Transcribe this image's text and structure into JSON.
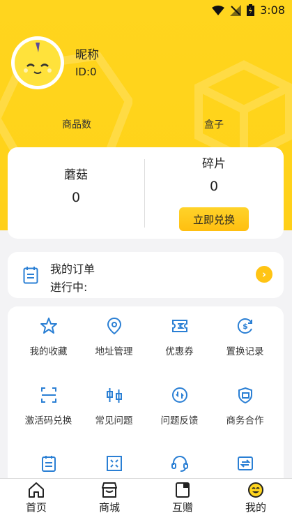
{
  "status_bar": {
    "time": "3:08"
  },
  "profile": {
    "nickname": "昵称",
    "user_id": "ID:0"
  },
  "stats": {
    "goods_label": "商品数",
    "box_label": "盒子"
  },
  "assets": {
    "mushroom_label": "蘑菇",
    "mushroom_value": "0",
    "fragment_label": "碎片",
    "fragment_value": "0",
    "redeem_label": "立即兑换"
  },
  "order": {
    "title": "我的订单",
    "status": "进行中:"
  },
  "grid": [
    {
      "label": "我的收藏",
      "icon": "star-icon"
    },
    {
      "label": "地址管理",
      "icon": "location-icon"
    },
    {
      "label": "优惠券",
      "icon": "coupon-icon"
    },
    {
      "label": "置换记录",
      "icon": "exchange-record-icon"
    },
    {
      "label": "激活码兑换",
      "icon": "scan-icon"
    },
    {
      "label": "常见问题",
      "icon": "faq-icon"
    },
    {
      "label": "问题反馈",
      "icon": "feedback-icon"
    },
    {
      "label": "商务合作",
      "icon": "business-icon"
    },
    {
      "label": "",
      "icon": "clipboard-icon"
    },
    {
      "label": "",
      "icon": "grid-frame-icon"
    },
    {
      "label": "",
      "icon": "headset-icon"
    },
    {
      "label": "",
      "icon": "transfer-icon"
    }
  ],
  "tabs": [
    {
      "label": "首页",
      "icon": "home-icon"
    },
    {
      "label": "商城",
      "icon": "store-icon"
    },
    {
      "label": "互赠",
      "icon": "gift-card-icon"
    },
    {
      "label": "我的",
      "icon": "profile-face-icon"
    }
  ],
  "colors": {
    "accent": "#ffd51e",
    "icon_blue": "#2a7fd4",
    "button_yellow": "#ffc414"
  }
}
